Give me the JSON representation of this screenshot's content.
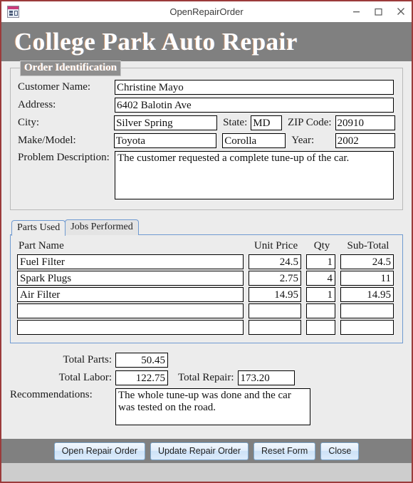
{
  "window": {
    "title": "OpenRepairOrder",
    "app_icon": "access-form-icon",
    "controls": {
      "minimize": "minimize-icon",
      "maximize": "maximize-icon",
      "close": "close-icon"
    },
    "border_color": "#9b3b3b"
  },
  "banner": {
    "title": "College Park Auto Repair",
    "background": "#808080",
    "text_color": "#ffffff"
  },
  "order_identification": {
    "legend": "Order Identification",
    "labels": {
      "customer_name": "Customer Name:",
      "address": "Address:",
      "city": "City:",
      "state": "State:",
      "zip_code": "ZIP Code:",
      "make_model": "Make/Model:",
      "year": "Year:",
      "problem_description": "Problem Description:"
    },
    "values": {
      "customer_name": "Christine Mayo",
      "address": "6402 Balotin Ave",
      "city": "Silver Spring",
      "state": "MD",
      "zip_code": "20910",
      "make": "Toyota",
      "model": "Corolla",
      "year": "2002",
      "problem_description": "The customer requested a complete tune-up of the car."
    }
  },
  "tabs": {
    "items": [
      {
        "label": "Parts Used",
        "active": true
      },
      {
        "label": "Jobs Performed",
        "active": false
      }
    ],
    "border_color": "#6f9ad1"
  },
  "parts_table": {
    "headers": {
      "part_name": "Part Name",
      "unit_price": "Unit Price",
      "qty": "Qty",
      "sub_total": "Sub-Total"
    },
    "rows": [
      {
        "part_name": "Fuel Filter",
        "unit_price": "24.5",
        "qty": "1",
        "sub_total": "24.5"
      },
      {
        "part_name": "Spark Plugs",
        "unit_price": "2.75",
        "qty": "4",
        "sub_total": "11"
      },
      {
        "part_name": "Air Filter",
        "unit_price": "14.95",
        "qty": "1",
        "sub_total": "14.95"
      },
      {
        "part_name": "",
        "unit_price": "",
        "qty": "",
        "sub_total": ""
      },
      {
        "part_name": "",
        "unit_price": "",
        "qty": "",
        "sub_total": ""
      }
    ]
  },
  "totals": {
    "labels": {
      "total_parts": "Total Parts:",
      "total_labor": "Total Labor:",
      "total_repair": "Total Repair:",
      "recommendations": "Recommendations:"
    },
    "values": {
      "total_parts": "50.45",
      "total_labor": "122.75",
      "total_repair": "173.20",
      "recommendations": "The whole tune-up was done and the car was tested on the road."
    }
  },
  "footer": {
    "buttons": [
      {
        "label": "Open Repair Order"
      },
      {
        "label": "Update Repair Order"
      },
      {
        "label": "Reset Form"
      },
      {
        "label": "Close"
      }
    ]
  }
}
